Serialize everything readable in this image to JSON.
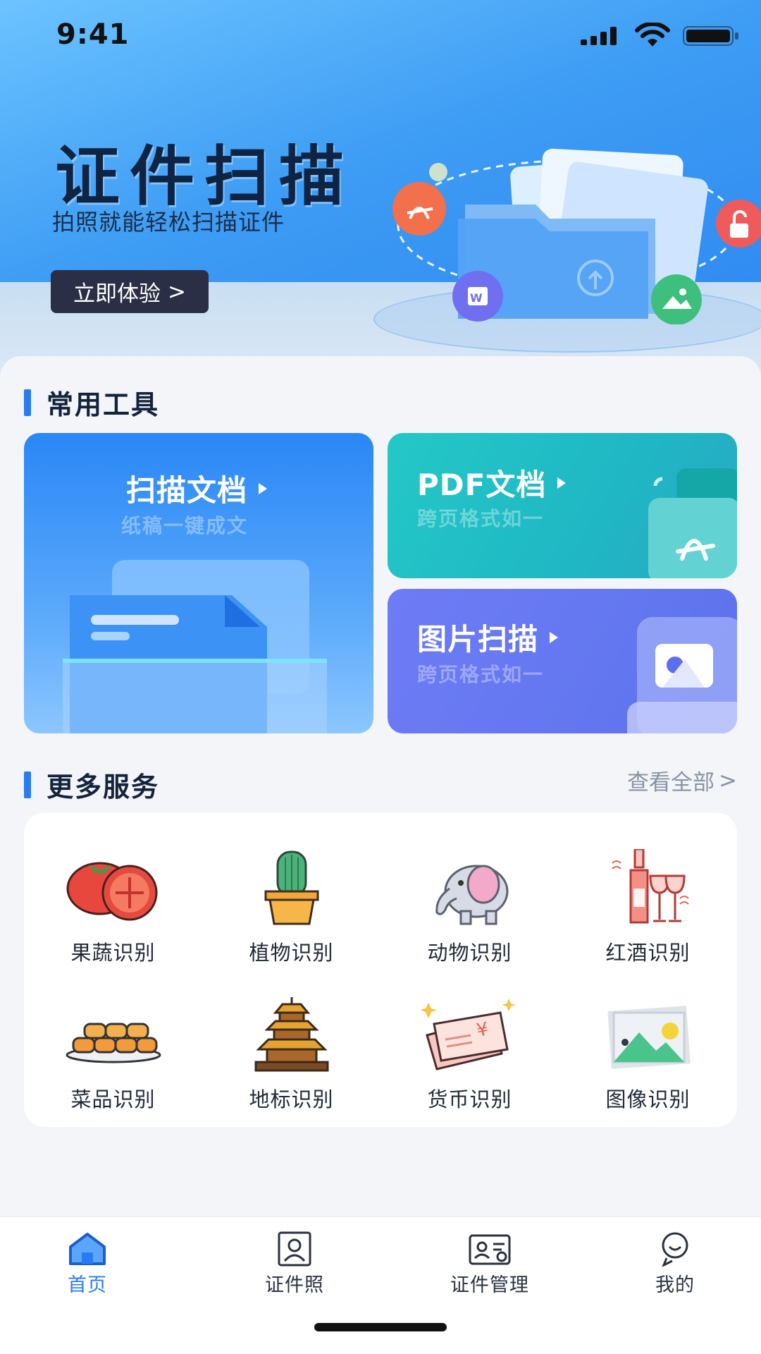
{
  "status_bar": {
    "time": "9:41"
  },
  "hero": {
    "title": "证件扫描",
    "subtitle": "拍照就能轻松扫描证件",
    "cta_label": "立即体验",
    "cta_arrow": ">"
  },
  "common_tools": {
    "title": "常用工具",
    "cards": [
      {
        "title": "扫描文档",
        "subtitle": "纸稿一键成文"
      },
      {
        "title": "PDF文档",
        "subtitle": "跨页格式如一"
      },
      {
        "title": "图片扫描",
        "subtitle": "跨页格式如一"
      }
    ]
  },
  "more_services": {
    "title": "更多服务",
    "view_all": "查看全部",
    "view_all_arrow": ">",
    "items": [
      {
        "label": "果蔬识别",
        "icon": "tomato-icon"
      },
      {
        "label": "植物识别",
        "icon": "cactus-icon"
      },
      {
        "label": "动物识别",
        "icon": "elephant-icon"
      },
      {
        "label": "红酒识别",
        "icon": "wine-icon"
      },
      {
        "label": "菜品识别",
        "icon": "dish-icon"
      },
      {
        "label": "地标识别",
        "icon": "temple-icon"
      },
      {
        "label": "货币识别",
        "icon": "banknote-icon"
      },
      {
        "label": "图像识别",
        "icon": "picture-icon"
      }
    ]
  },
  "tabbar": {
    "active": "首页",
    "tabs": [
      {
        "label": "首页",
        "icon": "home-icon"
      },
      {
        "label": "证件照",
        "icon": "id-photo-icon"
      },
      {
        "label": "证件管理",
        "icon": "id-card-manage-icon"
      },
      {
        "label": "我的",
        "icon": "profile-icon"
      }
    ]
  },
  "colors": {
    "accent": "#2a7bf3",
    "hero_top": "#6cc3ff",
    "hero_bottom": "#2c86f0",
    "pdf_card": "#24c8c7",
    "image_card": "#6377f0",
    "cta_bg": "#2b2f45"
  }
}
